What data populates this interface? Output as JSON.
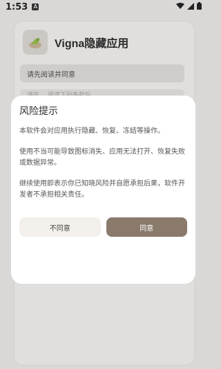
{
  "status_bar": {
    "time": "1:53",
    "app_icon": "A",
    "icons": [
      "wifi-icon",
      "signal-icon",
      "battery-icon"
    ]
  },
  "app": {
    "title": "Vigna隐藏应用",
    "notice": "请先阅读并同意",
    "partial_text": "请在… 阅读下列条款后…"
  },
  "dialog": {
    "title": "风险提示",
    "paragraphs": [
      "本软件会对应用执行隐藏、恢复、冻结等操作。",
      "使用不当可能导致图标消失、应用无法打开、恢复失败或数据异常。",
      "继续使用即表示你已知晓风险并自愿承担后果，软件开发者不承担相关责任。"
    ],
    "decline_label": "不同意",
    "accept_label": "同意"
  },
  "colors": {
    "accent": "#8a7a6c",
    "secondary_button": "#f3f0eb",
    "background_dim": "#d9d8d6"
  }
}
